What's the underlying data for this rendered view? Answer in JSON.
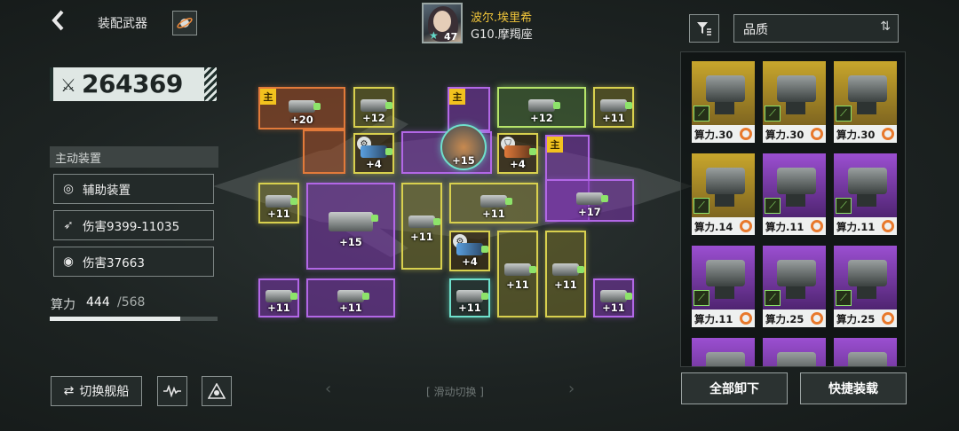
{
  "header": {
    "back_icon": "chevron-left-icon",
    "title": "装配武器",
    "planet_icon": "planet-icon",
    "pilot": {
      "name": "波尔.埃里希",
      "level": "47",
      "rank": "G10.摩羯座"
    }
  },
  "left_panel": {
    "power_value": "264369",
    "active_device_header": "主动装置",
    "stats": [
      {
        "icon": "gear-ring-icon",
        "label": "辅助装置"
      },
      {
        "icon": "missile-icon",
        "label": "伤害9399-11035"
      },
      {
        "icon": "target-ring-icon",
        "label": "伤害37663"
      }
    ],
    "compute": {
      "label": "算力",
      "current": "444",
      "max": "/568",
      "fraction": 0.78
    }
  },
  "bottom": {
    "switch_ship_label": "切换舰船",
    "swipe_hint": "[ 滑动切换 ]"
  },
  "grid": {
    "main_tag": "主",
    "slot_levels": [
      "+20",
      "+12",
      "+15",
      "+12",
      "+11",
      "+4",
      "+4",
      "+11",
      "+15",
      "+11",
      "+11",
      "+17",
      "+11",
      "+4",
      "+11",
      "+11",
      "+11",
      "+11",
      "+11",
      "+11"
    ]
  },
  "inventory": {
    "sort_label": "品质",
    "cards": [
      {
        "rarity": "gold",
        "label": "算力.30"
      },
      {
        "rarity": "gold",
        "label": "算力.30"
      },
      {
        "rarity": "gold",
        "label": "算力.30"
      },
      {
        "rarity": "gold",
        "label": "算力.14"
      },
      {
        "rarity": "purple",
        "label": "算力.11"
      },
      {
        "rarity": "purple",
        "label": "算力.11"
      },
      {
        "rarity": "purple",
        "label": "算力.11"
      },
      {
        "rarity": "purple",
        "label": "算力.25"
      },
      {
        "rarity": "purple",
        "label": "算力.25"
      }
    ],
    "unload_all_label": "全部卸下",
    "quick_equip_label": "快捷装载"
  },
  "colors": {
    "gold": "#d8d04e",
    "purple": "#b267e6",
    "orange": "#e27a3a",
    "accent_green": "#8de36a"
  }
}
